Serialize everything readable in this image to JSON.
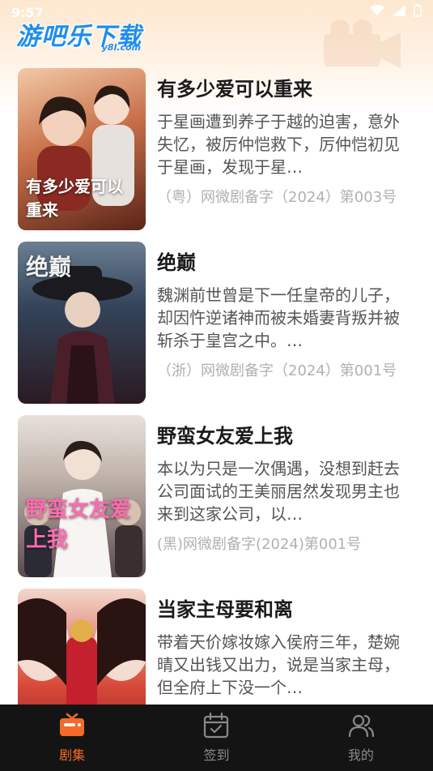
{
  "status_bar": {
    "time": "9:57"
  },
  "header": {
    "logo_main": "游吧乐下载",
    "logo_sub": "y8l.com"
  },
  "dramas": [
    {
      "title": "有多少爱可以重来",
      "desc": "于星画遭到养子于越的迫害，意外失忆，被厉仲恺救下，厉仲恺初见于星画，发现于星…",
      "record": "（粤）网微剧备字（2024）第003号",
      "poster_text": "有多少爱可以重来",
      "poster_bg": "#7a3c2c"
    },
    {
      "title": "绝巅",
      "desc": "魏渊前世曾是下一任皇帝的儿子，却因忤逆诸神而被未婚妻背叛并被斩杀于皇宫之中。…",
      "record": "（浙）网微剧备字（2024）第001号",
      "poster_text": "绝巅",
      "poster_bg": "#2c3a4a"
    },
    {
      "title": "野蛮女友爱上我",
      "desc": "本以为只是一次偶遇，没想到赶去公司面试的王美丽居然发现男主也来到这家公司，以…",
      "record": "(黑)网微剧备字(2024)第001号",
      "poster_text": "野蛮女友爱上我",
      "poster_bg": "#6a5a66"
    },
    {
      "title": "当家主母要和离",
      "desc": "带着天价嫁妆嫁入侯府三年，楚婉晴又出钱又出力，说是当家主母，但全府上下没一个…",
      "record": "",
      "poster_text": "",
      "poster_bg": "#b8283a"
    }
  ],
  "nav": {
    "items": [
      {
        "label": "剧集",
        "icon": "tv-icon",
        "active": true
      },
      {
        "label": "签到",
        "icon": "calendar-check-icon",
        "active": false
      },
      {
        "label": "我的",
        "icon": "users-icon",
        "active": false
      }
    ],
    "active_color": "#f36a2a",
    "inactive_color": "#8a8a8a"
  }
}
